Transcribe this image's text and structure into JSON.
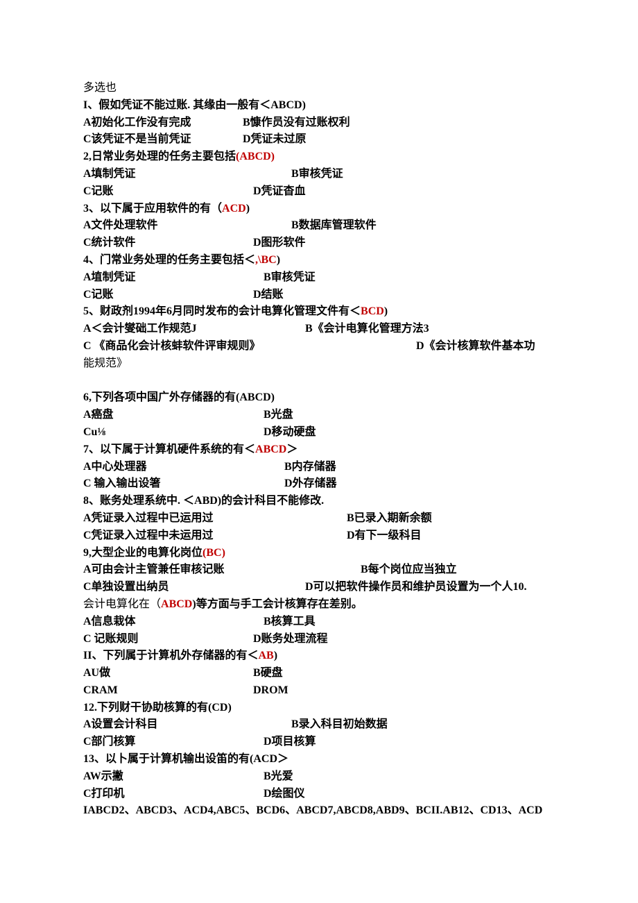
{
  "title": "多选也",
  "q1": {
    "stem_pre": "I、假如凭证不能过账. 其缘由一般有＜",
    "ans": "ABCD",
    "stem_post": ")",
    "a": "A初始化工作没有完成",
    "b": "B慷作员没有过账权利",
    "c": "C该凭证不是当前凭证",
    "d": "D凭证未过原"
  },
  "q2": {
    "stem_pre": "2,日常业务处理的任务主要包括",
    "ans": "(ABCD)",
    "a": "A填制凭证",
    "b": "B审核凭证",
    "c": "C记账",
    "d": "D凭证杳血"
  },
  "q3": {
    "stem_pre": "3、以下属于应用软件的有（",
    "ans": "ACD",
    "stem_post": ")",
    "a": "A文件处理软件",
    "b": "B数据库管理软件",
    "c": "C统计软件",
    "d": "D图形软件"
  },
  "q4": {
    "stem_pre": "4、门常业务处理的任务主要包括＜",
    "ans": ",\\BC",
    "stem_post": ")",
    "a": "A埴制凭证",
    "b": "B审核凭证",
    "c": "C记账",
    "d": "D结账"
  },
  "q5": {
    "stem_pre": "5、财政剂1994年6月同时发布的会计电算化管理文件有＜",
    "ans": "BCD",
    "stem_post": ")",
    "a": "A＜会计燮础工作规范J",
    "b": "B《会计电算化管理方法3",
    "c_pre": "C       《商品化会计核蚌软件评审规则》",
    "d": "D《会计核算软件基本功",
    "d2": "能规范》"
  },
  "q6": {
    "stem_pre": "6,下列各项中国广外存储器的有",
    "ans": "(ABCD)",
    "a": "A癌盘",
    "b": "B光盘",
    "c": "Cu⅛",
    "d": "D移动硬盘"
  },
  "q7": {
    "stem_pre": "7、以下属于计算机硬件系统的有＜",
    "ans": "ABCD",
    "stem_post": "＞",
    "a": "A中心处理器",
    "b": "B内存储器",
    "c": "C    输入输出设箸",
    "d": "D外存储器"
  },
  "q8": {
    "stem_pre": "8、账务处理系统中. ＜",
    "ans": "ABD",
    "stem_post": ")的会计科目不能修改.",
    "a": "A凭证录入过程中已运用过",
    "b": "B已录入期新余额",
    "c": "C凭证录入过程中未运用过",
    "d": "D有下一级科目"
  },
  "q9": {
    "stem_pre": "9,大型企业的电算化岗位",
    "ans": "(BC)",
    "a": "A可由会计主管兼任审核记账",
    "b": "B每个岗位应当独立",
    "c": "C单独设置出纳员",
    "d": "D可以把软件操作员和维护员设置为一个人10."
  },
  "q10": {
    "stem_pre": "会计电算化在（",
    "ans": "ABCD",
    "stem_post": ")等方面与手工会计核算存在差别。",
    "a": "A信息栽体",
    "b": "B核算工具",
    "c": "C      记账规则",
    "d": "D账务处理流程"
  },
  "q11": {
    "stem_pre": "II、下列属于计算机外存储器的有＜",
    "ans": "AB",
    "stem_post": ")",
    "a": "AU做",
    "b": "B硬盘",
    "c": "CRAM",
    "d": "DROM"
  },
  "q12": {
    "stem_pre": "12.下列财干协助核算的有",
    "ans": "(CD)",
    "a": "A设置会计科目",
    "b": "B录入科目初始数据",
    "c": "C部门核算",
    "d": "D项目核算"
  },
  "q13": {
    "stem_pre": "13、以卜属于计算机输出设笛的有",
    "ans": "(ACD",
    "stem_post": "＞",
    "a": "AW示撇",
    "b": "B光爱",
    "c": "C打印机",
    "d": "D绘图仪"
  },
  "footer": "IABCD2、ABCD3、ACD4,ABC5、BCD6、ABCD7,ABCD8,ABD9、BCII.AB12、CD13、ACD"
}
